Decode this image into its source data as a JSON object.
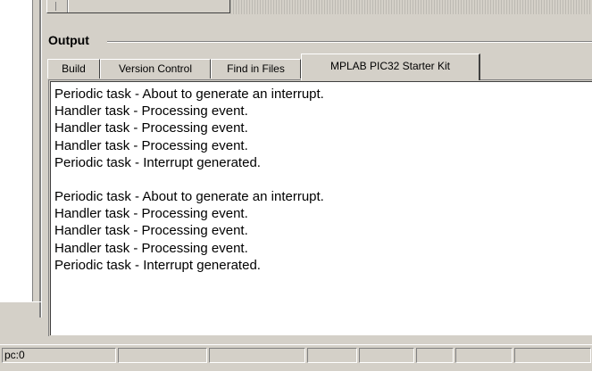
{
  "output": {
    "title": "Output",
    "tabs": [
      {
        "label": "Build"
      },
      {
        "label": "Version Control"
      },
      {
        "label": "Find in Files"
      },
      {
        "label": "MPLAB PIC32 Starter Kit",
        "active": true
      }
    ],
    "lines": [
      "Periodic task - About to generate an interrupt.",
      "Handler task - Processing event.",
      "Handler task - Processing event.",
      "Handler task - Processing event.",
      "Periodic task - Interrupt generated.",
      "",
      "Periodic task - About to generate an interrupt.",
      "Handler task - Processing event.",
      "Handler task - Processing event.",
      "Handler task - Processing event.",
      "Periodic task - Interrupt generated."
    ]
  },
  "status_bar": {
    "pc": "pc:0",
    "cells": [
      "",
      "",
      "",
      "",
      "",
      "",
      "",
      ""
    ]
  }
}
